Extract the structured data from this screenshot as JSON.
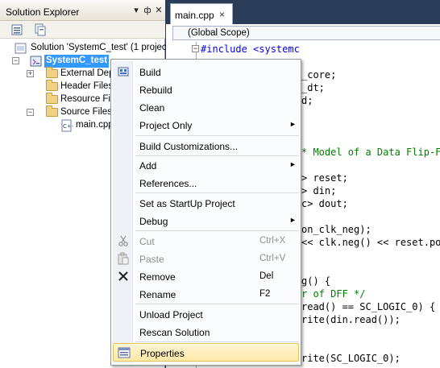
{
  "solution_explorer": {
    "title": "Solution Explorer",
    "pin_glyph": "▾",
    "pin_icon": "ф",
    "close_glyph": "✕",
    "tree": {
      "solution_label": "Solution 'SystemC_test' (1 project)",
      "project_label": "SystemC_test",
      "external_deps_label": "External Dep",
      "header_files_label": "Header Files",
      "resource_files_label": "Resource File",
      "source_files_label": "Source Files",
      "main_cpp_label": "main.cpp"
    }
  },
  "editor": {
    "tab_label": "main.cpp",
    "tab_close": "×",
    "scope_label": "(Global Scope)",
    "lines": [
      "#include <systemc",
      "_core;",
      "_dt;",
      "d;",
      "* Model of a Data Flip-F",
      "> reset;",
      "> din;",
      "c> dout;",
      "on_clk_neg);",
      "<< clk.neg() << reset.po",
      "g() {",
      "r of DFF */",
      "read() == SC_LOGIC_0) {",
      "rite(din.read());",
      "rite(SC_LOGIC_0);"
    ]
  },
  "context_menu": {
    "items": [
      {
        "label": "Build",
        "icon": "build-icon"
      },
      {
        "label": "Rebuild"
      },
      {
        "label": "Clean"
      },
      {
        "label": "Project Only",
        "submenu": "►"
      },
      {
        "label": "Build Customizations..."
      },
      {
        "label": "Add",
        "submenu": "►"
      },
      {
        "label": "References..."
      },
      {
        "label": "Set as StartUp Project"
      },
      {
        "label": "Debug",
        "submenu": "►"
      },
      {
        "label": "Cut",
        "shortcut": "Ctrl+X",
        "disabled": true
      },
      {
        "label": "Paste",
        "shortcut": "Ctrl+V",
        "disabled": true
      },
      {
        "label": "Remove",
        "shortcut": "Del"
      },
      {
        "label": "Rename",
        "shortcut": "F2"
      },
      {
        "label": "Unload Project"
      },
      {
        "label": "Rescan Solution"
      },
      {
        "label": "Properties"
      }
    ]
  },
  "colors": {
    "accent_bg": "#2b3c59",
    "highlight": "#fde8a8",
    "selection": "#3399ff",
    "code_blue": "#0000ff",
    "code_red": "#a31515",
    "code_comment": "#008000"
  }
}
